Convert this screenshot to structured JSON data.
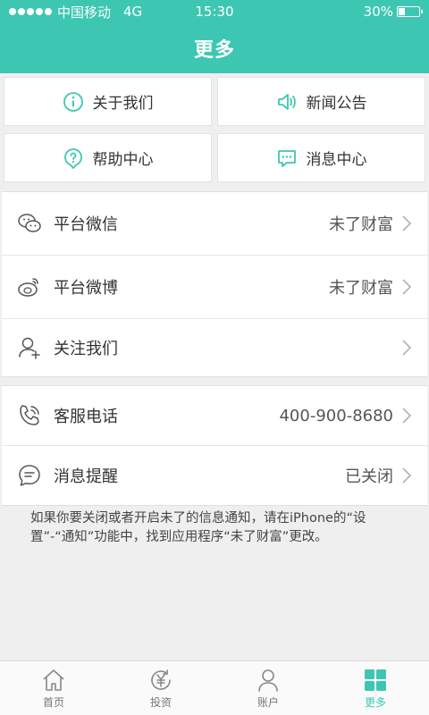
{
  "statusbar": {
    "carrier": "中国移动",
    "network": "4G",
    "time": "15:30",
    "battery": "30%",
    "battery_level": 0.3
  },
  "header": {
    "title": "更多"
  },
  "grid": [
    {
      "label": "关于我们",
      "icon": "info-icon"
    },
    {
      "label": "新闻公告",
      "icon": "speaker-icon"
    },
    {
      "label": "帮助中心",
      "icon": "help-icon"
    },
    {
      "label": "消息中心",
      "icon": "message-icon"
    }
  ],
  "social": [
    {
      "label": "平台微信",
      "value": "未了财富",
      "icon": "wechat-icon"
    },
    {
      "label": "平台微博",
      "value": "未了财富",
      "icon": "weibo-icon"
    },
    {
      "label": "关注我们",
      "value": "",
      "icon": "add-user-icon"
    }
  ],
  "service": [
    {
      "label": "客服电话",
      "value": "400-900-8680",
      "icon": "phone-icon"
    },
    {
      "label": "消息提醒",
      "value": "已关闭",
      "icon": "chat-icon"
    }
  ],
  "note": "如果你要关闭或者开启未了的信息通知，请在iPhone的“设置”-“通知”功能中，找到应用程序“未了财富”更改。",
  "tabbar": [
    {
      "label": "首页",
      "icon": "home-icon"
    },
    {
      "label": "投资",
      "icon": "invest-icon"
    },
    {
      "label": "账户",
      "icon": "account-icon"
    },
    {
      "label": "更多",
      "icon": "grid-icon",
      "active": true
    }
  ],
  "colors": {
    "accent": "#3dc7b2"
  }
}
